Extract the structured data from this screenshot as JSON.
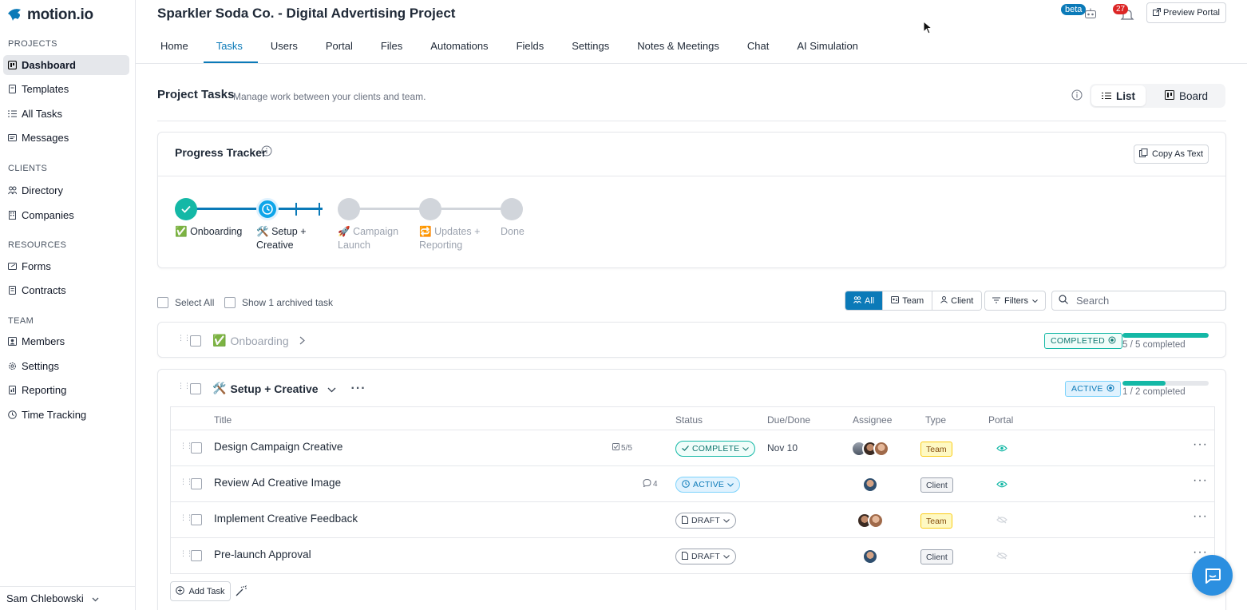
{
  "app": {
    "logo_text": "motion.io"
  },
  "sidebar": {
    "sections": [
      {
        "title": "PROJECTS",
        "items": [
          {
            "label": "Dashboard",
            "icon": "dashboard-icon"
          },
          {
            "label": "Templates",
            "icon": "template-icon"
          },
          {
            "label": "All Tasks",
            "icon": "list-icon"
          },
          {
            "label": "Messages",
            "icon": "message-icon"
          }
        ]
      },
      {
        "title": "CLIENTS",
        "items": [
          {
            "label": "Directory",
            "icon": "users-icon"
          },
          {
            "label": "Companies",
            "icon": "building-icon"
          }
        ]
      },
      {
        "title": "RESOURCES",
        "items": [
          {
            "label": "Forms",
            "icon": "form-icon"
          },
          {
            "label": "Contracts",
            "icon": "contract-icon"
          }
        ]
      },
      {
        "title": "TEAM",
        "items": [
          {
            "label": "Members",
            "icon": "member-icon"
          },
          {
            "label": "Settings",
            "icon": "gear-icon"
          },
          {
            "label": "Reporting",
            "icon": "report-icon"
          },
          {
            "label": "Time Tracking",
            "icon": "clock-icon"
          }
        ]
      }
    ],
    "active_item": "Dashboard",
    "user_name": "Sam Chlebowski"
  },
  "header": {
    "project_title": "Sparkler Soda Co. - Digital Advertising Project",
    "tabs": [
      "Home",
      "Tasks",
      "Users",
      "Portal",
      "Files",
      "Automations",
      "Fields",
      "Settings",
      "Notes & Meetings",
      "Chat",
      "AI Simulation"
    ],
    "active_tab": "Tasks",
    "beta_label": "beta",
    "notification_count": "27",
    "preview_portal_label": "Preview Portal"
  },
  "section": {
    "title": "Project Tasks",
    "subtitle": "Manage work between your clients and team.",
    "view_list_label": "List",
    "view_board_label": "Board"
  },
  "progress_tracker": {
    "title": "Progress Tracker",
    "copy_label": "Copy As Text",
    "steps": [
      {
        "emoji": "✅",
        "label": "Onboarding",
        "state": "done"
      },
      {
        "emoji": "🛠️",
        "label": "Setup + Creative",
        "state": "current"
      },
      {
        "emoji": "🚀",
        "label": "Campaign Launch",
        "state": "pending"
      },
      {
        "emoji": "🔁",
        "label": "Updates + Reporting",
        "state": "pending"
      },
      {
        "emoji": "",
        "label": "Done",
        "state": "pending"
      }
    ]
  },
  "filters": {
    "select_all_label": "Select All",
    "show_archived_label": "Show 1 archived task",
    "segments": [
      "All",
      "Team",
      "Client"
    ],
    "active_segment": "All",
    "filters_label": "Filters",
    "search_placeholder": "Search"
  },
  "groups": [
    {
      "emoji": "✅",
      "name": "Onboarding",
      "status": "COMPLETED",
      "progress_text": "5 / 5 completed",
      "progress_fraction": 1.0
    },
    {
      "emoji": "🛠️",
      "name": "Setup + Creative",
      "status": "ACTIVE",
      "progress_text": "1 / 2 completed",
      "progress_fraction": 0.5,
      "columns": [
        "Title",
        "Status",
        "Due/Done",
        "Assignee",
        "Type",
        "Portal"
      ],
      "tasks": [
        {
          "title": "Design Campaign Creative",
          "meta": "5/5",
          "meta_icon": "checklist-icon",
          "status": "COMPLETE",
          "due": "Nov 10",
          "type": "Team",
          "portal_visible": true
        },
        {
          "title": "Review Ad Creative Image",
          "meta": "4",
          "meta_icon": "comment-icon",
          "status": "ACTIVE",
          "due": "",
          "type": "Client",
          "portal_visible": true
        },
        {
          "title": "Implement Creative Feedback",
          "meta": "",
          "meta_icon": "",
          "status": "DRAFT",
          "due": "",
          "type": "Team",
          "portal_visible": false
        },
        {
          "title": "Pre-launch Approval",
          "meta": "",
          "meta_icon": "",
          "status": "DRAFT",
          "due": "",
          "type": "Client",
          "portal_visible": false
        }
      ],
      "add_task_label": "Add Task"
    }
  ],
  "colors": {
    "accent": "#0b7ab8",
    "teal": "#14b8a6",
    "badge_red": "#dc2626",
    "team_yellow": "#facc15"
  }
}
